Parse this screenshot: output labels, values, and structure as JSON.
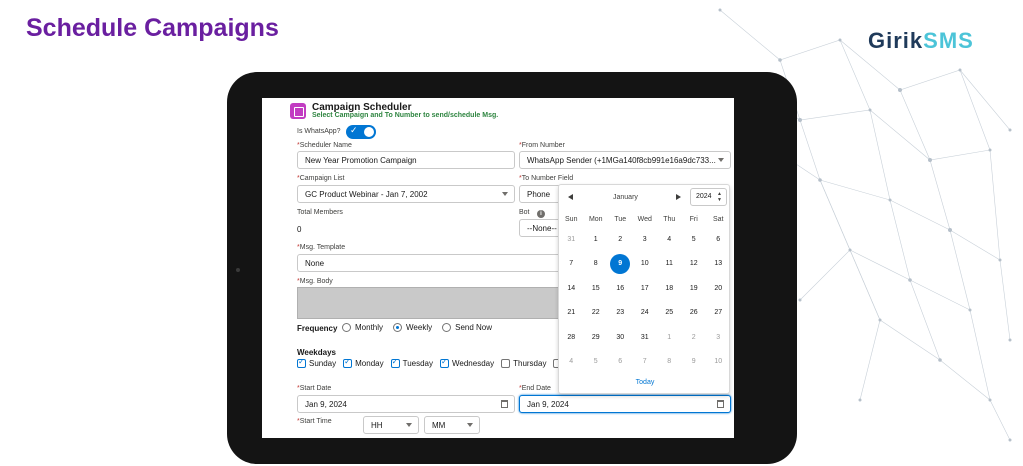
{
  "page_title": "Schedule Campaigns",
  "logo": {
    "part1": "Girik",
    "part2": "SMS"
  },
  "app": {
    "title": "Campaign Scheduler",
    "subtitle": "Select Campaign and To Number to send/schedule Msg."
  },
  "form": {
    "is_whatsapp_label": "Is WhatsApp?",
    "scheduler_name_label": "Scheduler Name",
    "scheduler_name_value": "New Year Promotion Campaign",
    "from_number_label": "From Number",
    "from_number_value": "WhatsApp Sender (+1MGa140f8cb991e16a9dc733...",
    "campaign_list_label": "Campaign List",
    "campaign_list_value": "GC Product Webinar - Jan 7, 2002",
    "to_number_label": "To Number Field",
    "to_number_value": "Phone",
    "total_members_label": "Total Members",
    "total_members_value": "0",
    "bot_label": "Bot",
    "bot_value": "--None--",
    "msg_template_label": "Msg. Template",
    "msg_template_value": "None",
    "msg_body_label": "Msg. Body",
    "frequency_label": "Frequency",
    "frequency_options": [
      "Monthly",
      "Weekly",
      "Send Now"
    ],
    "weekdays_label": "Weekdays",
    "weekdays": [
      "Sunday",
      "Monday",
      "Tuesday",
      "Wednesday",
      "Thursday"
    ],
    "start_date_label": "Start Date",
    "start_date_value": "Jan 9, 2024",
    "end_date_label": "End Date",
    "end_date_value": "Jan 9, 2024",
    "start_time_label": "Start Time",
    "hh_value": "HH",
    "mm_value": "MM"
  },
  "datepicker": {
    "month": "January",
    "year": "2024",
    "dow": [
      "Sun",
      "Mon",
      "Tue",
      "Wed",
      "Thu",
      "Fri",
      "Sat"
    ],
    "weeks": [
      [
        "31",
        "1",
        "2",
        "3",
        "4",
        "5",
        "6"
      ],
      [
        "7",
        "8",
        "9",
        "10",
        "11",
        "12",
        "13"
      ],
      [
        "14",
        "15",
        "16",
        "17",
        "18",
        "19",
        "20"
      ],
      [
        "21",
        "22",
        "23",
        "24",
        "25",
        "26",
        "27"
      ],
      [
        "28",
        "29",
        "30",
        "31",
        "1",
        "2",
        "3"
      ],
      [
        "4",
        "5",
        "6",
        "7",
        "8",
        "9",
        "10"
      ]
    ],
    "today_label": "Today"
  },
  "colors": {
    "title": "#6a1fa0",
    "accent": "#0176d3",
    "logo_dark": "#1f3a5a",
    "logo_light": "#4cc4d8"
  }
}
